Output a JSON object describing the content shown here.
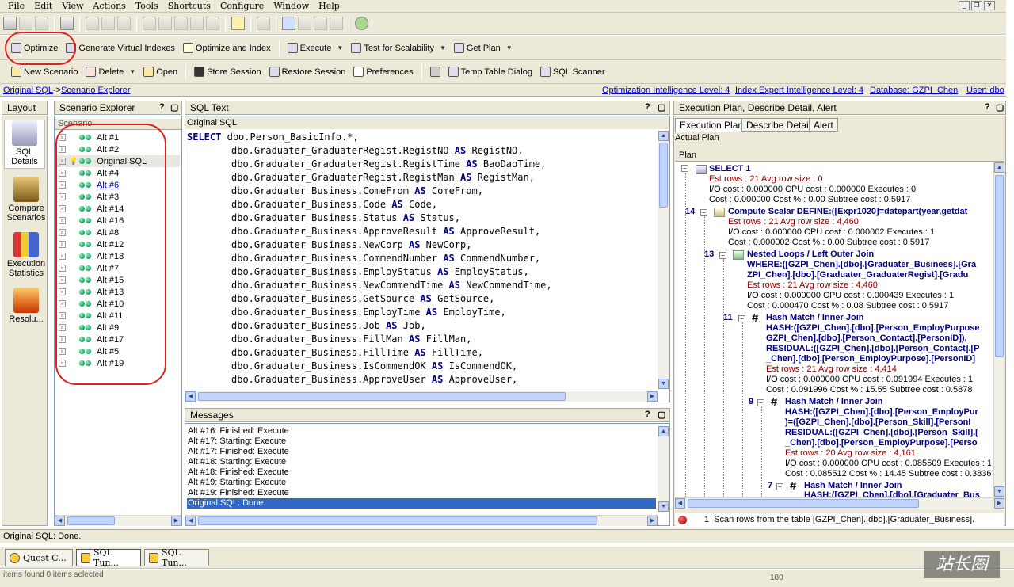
{
  "menu": [
    "File",
    "Edit",
    "View",
    "Actions",
    "Tools",
    "Shortcuts",
    "Configure",
    "Window",
    "Help"
  ],
  "toolbar1": {
    "optimize": "Optimize",
    "gen_virtual": "Generate Virtual Indexes",
    "opt_index": "Optimize and Index",
    "execute": "Execute",
    "test_scal": "Test for Scalability",
    "get_plan": "Get Plan"
  },
  "toolbar2": {
    "new_scenario": "New Scenario",
    "delete": "Delete",
    "open": "Open",
    "store_session": "Store Session",
    "restore_session": "Restore Session",
    "preferences": "Preferences",
    "temp_table": "Temp Table Dialog",
    "sql_scanner": "SQL Scanner"
  },
  "infobar": {
    "crumb1": "Original SQL",
    "crumb_sep": "->",
    "crumb2": "Scenario Explorer",
    "opt_level": "Optimization Intelligence Level: 4",
    "idx_level": "Index Expert Intelligence Level: 4",
    "database": "Database: GZPI_Chen",
    "user": "User: dbo"
  },
  "layout": {
    "title": "Layout",
    "items": [
      "SQL Details",
      "Compare Scenarios",
      "Execution Statistics",
      "Resolu..."
    ]
  },
  "scenario": {
    "title": "Scenario Explorer",
    "help": "?",
    "col": "Scenario",
    "items": [
      "Alt #1",
      "Alt #2",
      "Original SQL",
      "Alt #4",
      "Alt #6",
      "Alt #3",
      "Alt #14",
      "Alt #16",
      "Alt #8",
      "Alt #12",
      "Alt #18",
      "Alt #7",
      "Alt #15",
      "Alt #13",
      "Alt #10",
      "Alt #11",
      "Alt #9",
      "Alt #17",
      "Alt #5",
      "Alt #19"
    ]
  },
  "sql": {
    "title": "SQL Text",
    "help": "?",
    "sub": "Original SQL",
    "select_kw": "SELECT",
    "as_kw": "AS",
    "first": "dbo.Person_BasicInfo.*,",
    "lines": [
      [
        "dbo.Graduater_GraduaterRegist.RegistNO",
        "RegistNO,"
      ],
      [
        "dbo.Graduater_GraduaterRegist.RegistTime",
        "BaoDaoTime,"
      ],
      [
        "dbo.Graduater_GraduaterRegist.RegistMan",
        "RegistMan,"
      ],
      [
        "dbo.Graduater_Business.ComeFrom",
        "ComeFrom,"
      ],
      [
        "dbo.Graduater_Business.Code",
        "Code,"
      ],
      [
        "dbo.Graduater_Business.Status",
        "Status,"
      ],
      [
        "dbo.Graduater_Business.ApproveResult",
        "ApproveResult,"
      ],
      [
        "dbo.Graduater_Business.NewCorp",
        "NewCorp,"
      ],
      [
        "dbo.Graduater_Business.CommendNumber",
        "CommendNumber,"
      ],
      [
        "dbo.Graduater_Business.EmployStatus",
        "EmployStatus,"
      ],
      [
        "dbo.Graduater_Business.NewCommendTime",
        "NewCommendTime,"
      ],
      [
        "dbo.Graduater_Business.GetSource",
        "GetSource,"
      ],
      [
        "dbo.Graduater_Business.EmployTime",
        "EmployTime,"
      ],
      [
        "dbo.Graduater_Business.Job",
        "Job,"
      ],
      [
        "dbo.Graduater_Business.FillMan",
        "FillMan,"
      ],
      [
        "dbo.Graduater_Business.FillTime",
        "FillTime,"
      ],
      [
        "dbo.Graduater_Business.IsCommendOK",
        "IsCommendOK,"
      ],
      [
        "dbo.Graduater_Business.ApproveUser",
        "ApproveUser,"
      ]
    ]
  },
  "messages": {
    "title": "Messages",
    "help": "?",
    "items": [
      "Alt #16: Finished: Execute",
      "Alt #17: Starting: Execute",
      "Alt #17: Finished: Execute",
      "Alt #18: Starting: Execute",
      "Alt #18: Finished: Execute",
      "Alt #19: Starting: Execute",
      "Alt #19: Finished: Execute",
      "Original SQL: Done."
    ]
  },
  "plan": {
    "title": "Execution Plan, Describe Detail, Alert",
    "help": "?",
    "tabs": [
      "Execution Plan",
      "Describe Detail",
      "Alert"
    ],
    "actual": "Actual Plan",
    "label": "Plan",
    "nodes": {
      "n1_title": "SELECT 1",
      "n1_est": "Est rows : 21 Avg row size : 0",
      "n1_io": "I/O cost : 0.000000 CPU cost : 0.000000 Executes : 0",
      "n1_cost": "Cost : 0.000000 Cost % : 0.00 Subtree cost : 0.5917",
      "n14_num": "14",
      "n14_title": "Compute Scalar DEFINE:([Expr1020]=datepart(year,getdat",
      "n14_est": "Est rows : 21 Avg row size : 4,460",
      "n14_io": "I/O cost : 0.000000 CPU cost : 0.000002 Executes : 1",
      "n14_cost": "Cost : 0.000002 Cost % : 0.00 Subtree cost : 0.5917",
      "n13_num": "13",
      "n13_title": "Nested Loops / Left Outer Join",
      "n13_w1": "WHERE:([GZPI_Chen].[dbo].[Graduater_Business].[Gra",
      "n13_w2": "ZPI_Chen].[dbo].[Graduater_GraduaterRegist].[Gradu",
      "n13_est": "Est rows : 21 Avg row size : 4,460",
      "n13_io": "I/O cost : 0.000000 CPU cost : 0.000439 Executes : 1",
      "n13_cost": "Cost : 0.000470 Cost % : 0.08 Subtree cost : 0.5917",
      "n11_num": "11",
      "n11_title": "Hash Match / Inner Join",
      "n11_h1": "HASH:([GZPI_Chen].[dbo].[Person_EmployPurpose",
      "n11_h2": "GZPI_Chen].[dbo].[Person_Contact].[PersonID]),",
      "n11_h3": "RESIDUAL:([GZPI_Chen].[dbo].[Person_Contact].[P",
      "n11_h4": "_Chen].[dbo].[Person_EmployPurpose].[PersonID]",
      "n11_est": "Est rows : 21 Avg row size : 4,414",
      "n11_io": "I/O cost : 0.000000 CPU cost : 0.091994 Executes : 1",
      "n11_cost": "Cost : 0.091996 Cost % : 15.55 Subtree cost : 0.5878",
      "n9_num": "9",
      "n9_title": "Hash Match / Inner Join",
      "n9_h1": "HASH:([GZPI_Chen].[dbo].[Person_EmployPur",
      "n9_h2": ")=([GZPI_Chen].[dbo].[Person_Skill].[PersonI",
      "n9_h3": "RESIDUAL:([GZPI_Chen].[dbo].[Person_Skill].[",
      "n9_h4": "_Chen].[dbo].[Person_EmployPurpose].[Perso",
      "n9_est": "Est rows : 20 Avg row size : 4,161",
      "n9_io": "I/O cost : 0.000000 CPU cost : 0.085509 Executes : 1",
      "n9_cost": "Cost : 0.085512 Cost % : 14.45 Subtree cost : 0.3836",
      "n7_num": "7",
      "n7_title": "Hash Match / Inner Join",
      "n7_h1": "HASH:([GZPI_Chen].[dbo].[Graduater_Bus"
    },
    "alert_num": "1",
    "alert_text": "Scan rows from the table [GZPI_Chen].[dbo].[Graduater_Business]."
  },
  "status": "Original SQL: Done.",
  "tasks": [
    "Quest C...",
    "SQL Tun...",
    "SQL Tun..."
  ],
  "bottom": {
    "left": "items found   0 items selected",
    "right": "180"
  },
  "watermark": "站长圈"
}
